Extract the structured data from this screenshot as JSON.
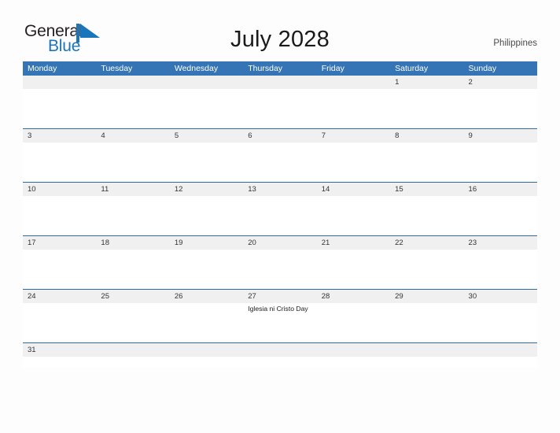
{
  "brand": {
    "name_part1": "General",
    "name_part2": "Blue",
    "flag_icon": "blue-triangle-flag-icon",
    "color_dark": "#231f20",
    "color_blue": "#1b75bb"
  },
  "header": {
    "title": "July 2028",
    "country": "Philippines"
  },
  "theme": {
    "header_blue": "#3575b5",
    "row_divider_blue": "#2e6da4",
    "date_band_gray": "#f0f0f0",
    "page_background": "#fdfdfd",
    "body_white": "#ffffff"
  },
  "calendar": {
    "month": "July",
    "year": "2028",
    "weekdays": [
      "Monday",
      "Tuesday",
      "Wednesday",
      "Thursday",
      "Friday",
      "Saturday",
      "Sunday"
    ],
    "weeks": [
      {
        "days": [
          {
            "number": "",
            "event": ""
          },
          {
            "number": "",
            "event": ""
          },
          {
            "number": "",
            "event": ""
          },
          {
            "number": "",
            "event": ""
          },
          {
            "number": "",
            "event": ""
          },
          {
            "number": "1",
            "event": ""
          },
          {
            "number": "2",
            "event": ""
          }
        ]
      },
      {
        "days": [
          {
            "number": "3",
            "event": ""
          },
          {
            "number": "4",
            "event": ""
          },
          {
            "number": "5",
            "event": ""
          },
          {
            "number": "6",
            "event": ""
          },
          {
            "number": "7",
            "event": ""
          },
          {
            "number": "8",
            "event": ""
          },
          {
            "number": "9",
            "event": ""
          }
        ]
      },
      {
        "days": [
          {
            "number": "10",
            "event": ""
          },
          {
            "number": "11",
            "event": ""
          },
          {
            "number": "12",
            "event": ""
          },
          {
            "number": "13",
            "event": ""
          },
          {
            "number": "14",
            "event": ""
          },
          {
            "number": "15",
            "event": ""
          },
          {
            "number": "16",
            "event": ""
          }
        ]
      },
      {
        "days": [
          {
            "number": "17",
            "event": ""
          },
          {
            "number": "18",
            "event": ""
          },
          {
            "number": "19",
            "event": ""
          },
          {
            "number": "20",
            "event": ""
          },
          {
            "number": "21",
            "event": ""
          },
          {
            "number": "22",
            "event": ""
          },
          {
            "number": "23",
            "event": ""
          }
        ]
      },
      {
        "days": [
          {
            "number": "24",
            "event": ""
          },
          {
            "number": "25",
            "event": ""
          },
          {
            "number": "26",
            "event": ""
          },
          {
            "number": "27",
            "event": "Iglesia ni Cristo Day"
          },
          {
            "number": "28",
            "event": ""
          },
          {
            "number": "29",
            "event": ""
          },
          {
            "number": "30",
            "event": ""
          }
        ]
      },
      {
        "days": [
          {
            "number": "31",
            "event": ""
          },
          {
            "number": "",
            "event": ""
          },
          {
            "number": "",
            "event": ""
          },
          {
            "number": "",
            "event": ""
          },
          {
            "number": "",
            "event": ""
          },
          {
            "number": "",
            "event": ""
          },
          {
            "number": "",
            "event": ""
          }
        ]
      }
    ]
  }
}
